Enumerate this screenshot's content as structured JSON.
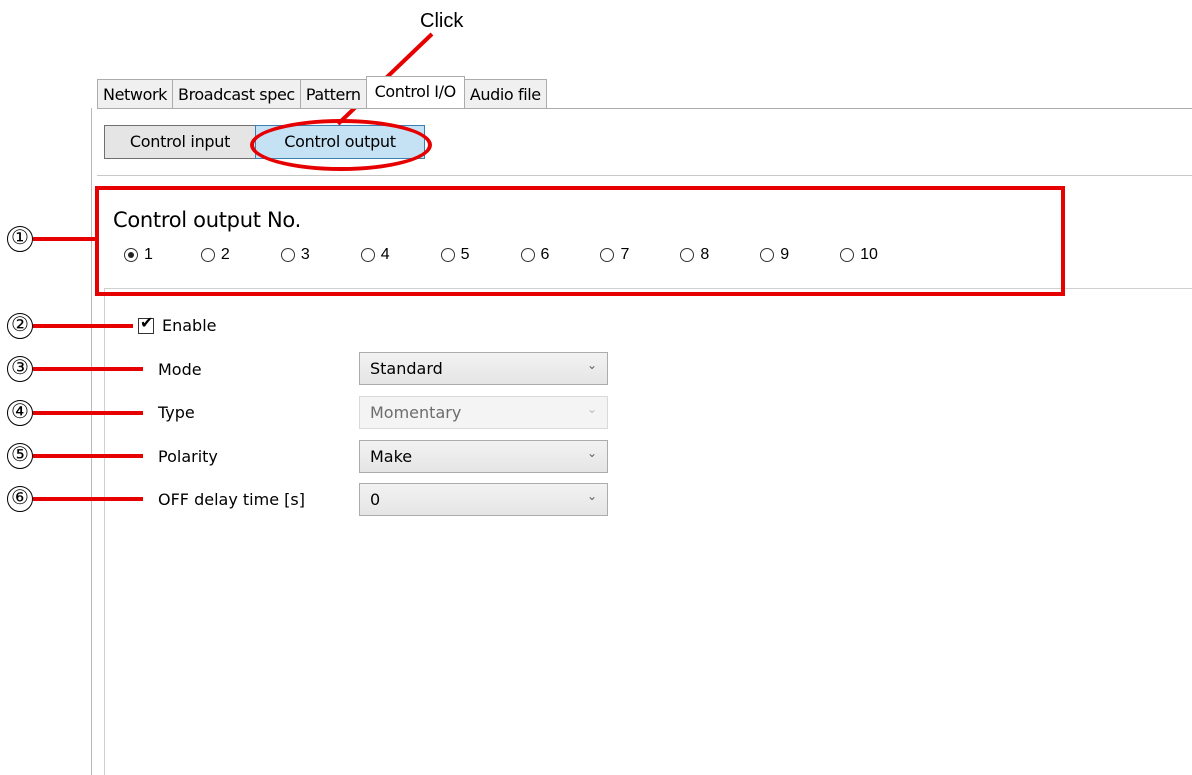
{
  "annotation": {
    "click_label": "Click"
  },
  "tabs": [
    {
      "label": "Network"
    },
    {
      "label": "Broadcast spec"
    },
    {
      "label": "Pattern"
    },
    {
      "label": "Control I/O",
      "active": true
    },
    {
      "label": "Audio file"
    }
  ],
  "subtabs": {
    "control_input": "Control input",
    "control_output": "Control output"
  },
  "output_no": {
    "title": "Control output No.",
    "options": [
      "1",
      "2",
      "3",
      "4",
      "5",
      "6",
      "7",
      "8",
      "9",
      "10"
    ],
    "selected": "1"
  },
  "markers": [
    "①",
    "②",
    "③",
    "④",
    "⑤",
    "⑥"
  ],
  "enable": {
    "label": "Enable",
    "checked": true
  },
  "fields": {
    "mode": {
      "label": "Mode",
      "value": "Standard"
    },
    "type": {
      "label": "Type",
      "value": "Momentary",
      "disabled": true
    },
    "polarity": {
      "label": "Polarity",
      "value": "Make"
    },
    "off_delay": {
      "label": "OFF delay time [s]",
      "value": "0"
    }
  },
  "colors": {
    "annotation": "#e60000",
    "selected_subtab": "#c5e2f5"
  }
}
